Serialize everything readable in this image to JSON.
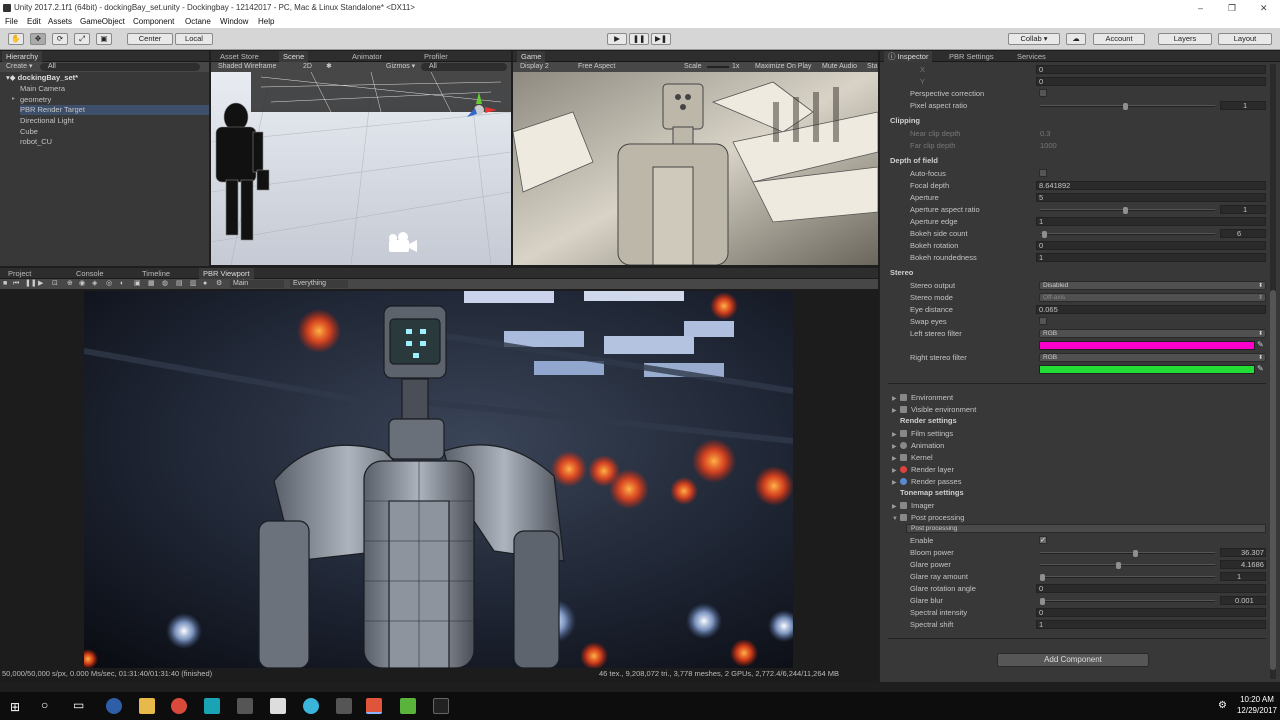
{
  "window": {
    "title": "Unity 2017.2.1f1 (64bit) - dockingBay_set.unity - Dockingbay - 12142017 - PC, Mac & Linux Standalone* <DX11>",
    "controls": [
      "–",
      "❐",
      "✕"
    ]
  },
  "menu": [
    "File",
    "Edit",
    "Assets",
    "GameObject",
    "Component",
    "Octane",
    "Window",
    "Help"
  ],
  "toolbar": {
    "pivot": "Center",
    "space": "Local",
    "collab": "Collab ▾",
    "account": "Account",
    "layers": "Layers",
    "layout": "Layout"
  },
  "hierarchy": {
    "tab": "Hierarchy",
    "create": "Create ▾",
    "search": "All",
    "scene": "dockingBay_set*",
    "items": [
      "Main Camera",
      "geometry",
      "PBR Render Target",
      "Directional Light",
      "Cube",
      "robot_CU"
    ]
  },
  "scene_tabs": {
    "asset_store": "Asset Store",
    "scene": "Scene",
    "animator": "Animator",
    "profiler": "Profiler",
    "shading": "Shaded Wireframe",
    "mode2d": "2D",
    "gizmos": "Gizmos ▾",
    "search": "All"
  },
  "game": {
    "tab": "Game",
    "display": "Display 2",
    "aspect": "Free Aspect",
    "scale_label": "Scale",
    "scale_value": "1x",
    "maximize": "Maximize On Play",
    "mute": "Mute Audio",
    "stats": "Sta"
  },
  "bottom_tabs": [
    "Project",
    "Console",
    "Timeline",
    "PBR Viewport"
  ],
  "viewport": {
    "camera": "Main",
    "layer": "Everything",
    "status_left": "50,000/50,000 s/px, 0.000 Ms/sec, 01:31:40/01:31:40 (finished)",
    "status_right": "46 tex., 9,208,072 tri., 3,778 meshes, 2 GPUs, 2,772.4/6,244/11,264 MB"
  },
  "inspector": {
    "tabs": [
      "Inspector",
      "PBR Settings",
      "Services"
    ],
    "rows_top": [
      {
        "label": "X",
        "value": "0"
      },
      {
        "label": "Y",
        "value": "0"
      }
    ],
    "perspective_correction": "Perspective correction",
    "pixel_aspect": {
      "label": "Pixel aspect ratio",
      "value": "1"
    },
    "clipping": {
      "header": "Clipping",
      "near": {
        "label": "Near clip depth",
        "value": "0.3"
      },
      "far": {
        "label": "Far clip depth",
        "value": "1000"
      }
    },
    "dof": {
      "header": "Depth of field",
      "autofocus": "Auto-focus",
      "focal": {
        "label": "Focal depth",
        "value": "8.641892"
      },
      "aperture": {
        "label": "Aperture",
        "value": "5"
      },
      "aperture_aspect": {
        "label": "Aperture aspect ratio",
        "value": "1"
      },
      "aperture_edge": {
        "label": "Aperture edge",
        "value": "1"
      },
      "bokeh_sides": {
        "label": "Bokeh side count",
        "value": "6"
      },
      "bokeh_rot": {
        "label": "Bokeh rotation",
        "value": "0"
      },
      "bokeh_round": {
        "label": "Bokeh roundedness",
        "value": "1"
      }
    },
    "stereo": {
      "header": "Stereo",
      "output": {
        "label": "Stereo output",
        "value": "Disabled"
      },
      "mode": {
        "label": "Stereo mode",
        "value": "Off-axis"
      },
      "eye": {
        "label": "Eye distance",
        "value": "0.065"
      },
      "swap": "Swap eyes",
      "left": {
        "label": "Left stereo filter",
        "value": "RGB",
        "color": "#ff00cc"
      },
      "right": {
        "label": "Right stereo filter",
        "value": "RGB",
        "color": "#22dd33"
      }
    },
    "components": {
      "environment": "Environment",
      "visible_env": "Visible environment",
      "render_header": "Render settings",
      "film": "Film settings",
      "animation": "Animation",
      "kernel": "Kernel",
      "render_layer": "Render layer",
      "render_passes": "Render passes",
      "tonemap_header": "Tonemap settings",
      "imager": "Imager",
      "post": "Post processing"
    },
    "post": {
      "title": "Post processing",
      "enable": "Enable",
      "check": "✓",
      "bloom": {
        "label": "Bloom power",
        "value": "36.307",
        "level": 0.55
      },
      "glare": {
        "label": "Glare power",
        "value": "4.1686",
        "level": 0.45
      },
      "glare_ray": {
        "label": "Glare ray amount",
        "value": "1",
        "level": 0.0
      },
      "glare_angle": {
        "label": "Glare rotation angle",
        "value": "0"
      },
      "glare_blur": {
        "label": "Glare blur",
        "value": "0.001",
        "level": 0.0
      },
      "spectral_intensity": {
        "label": "Spectral intensity",
        "value": "0"
      },
      "spectral_shift": {
        "label": "Spectral shift",
        "value": "1"
      }
    },
    "add_component": "Add Component"
  },
  "taskbar": {
    "time": "10:20 AM",
    "date": "12/29/2017"
  }
}
